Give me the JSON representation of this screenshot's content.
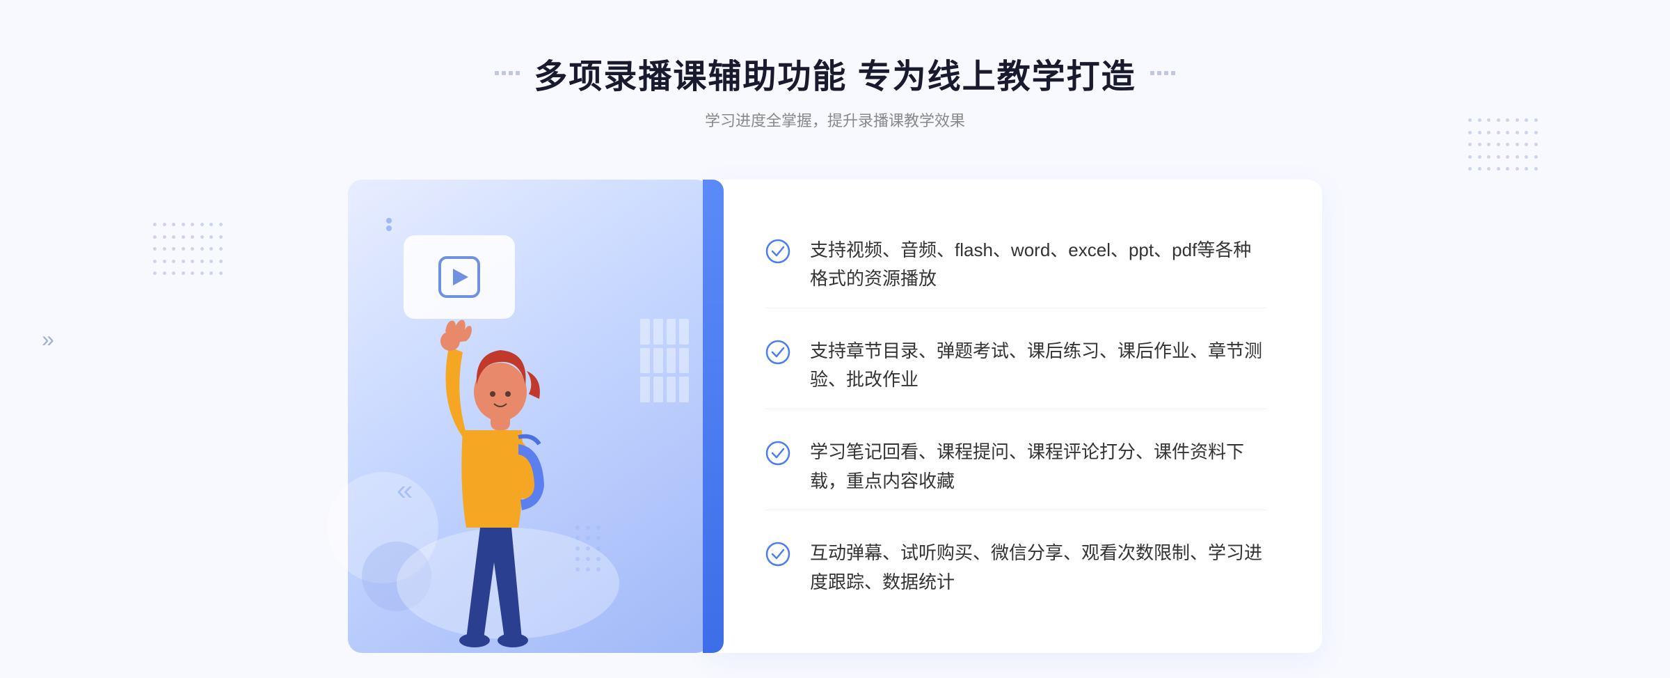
{
  "page": {
    "background_color": "#f5f7ff"
  },
  "header": {
    "main_title": "多项录播课辅助功能 专为线上教学打造",
    "sub_title": "学习进度全掌握，提升录播课教学效果"
  },
  "features": [
    {
      "id": 1,
      "text": "支持视频、音频、flash、word、excel、ppt、pdf等各种格式的资源播放"
    },
    {
      "id": 2,
      "text": "支持章节目录、弹题考试、课后练习、课后作业、章节测验、批改作业"
    },
    {
      "id": 3,
      "text": "学习笔记回看、课程提问、课程评论打分、课件资料下载，重点内容收藏"
    },
    {
      "id": 4,
      "text": "互动弹幕、试听购买、微信分享、观看次数限制、学习进度跟踪、数据统计"
    }
  ],
  "icons": {
    "check_circle": "✓",
    "play": "▶",
    "chevron_right": "»"
  }
}
